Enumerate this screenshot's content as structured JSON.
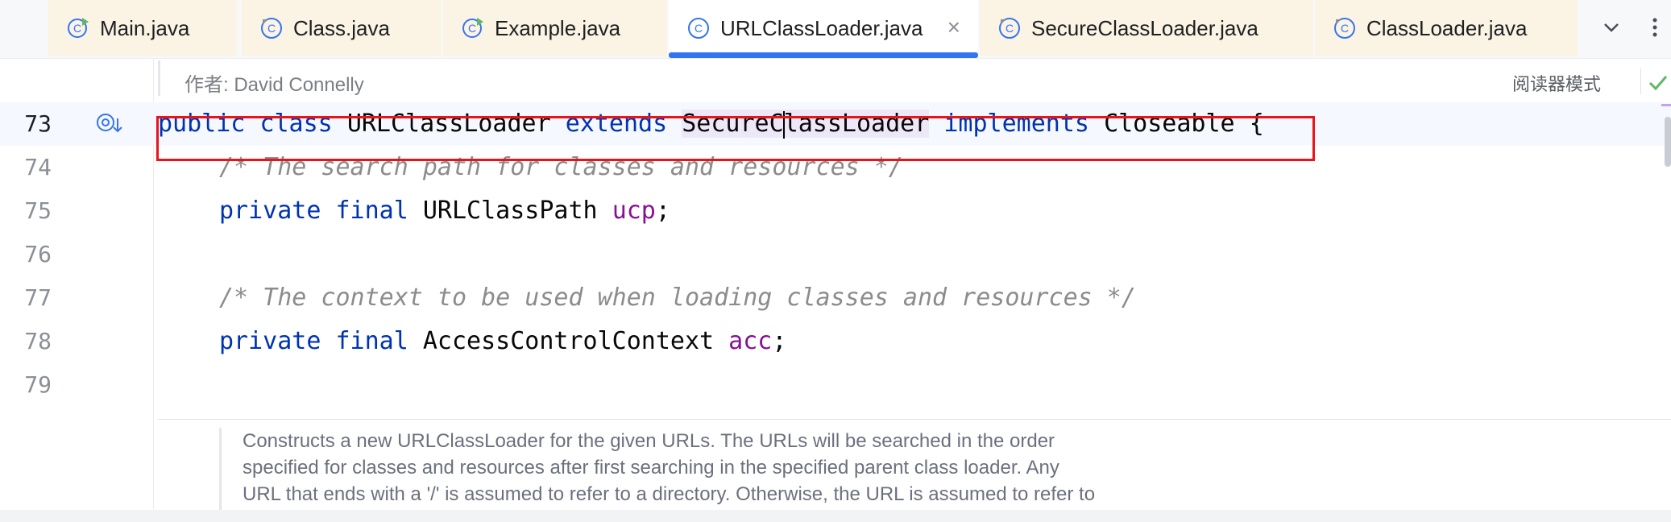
{
  "tabs": [
    {
      "label": "Main.java",
      "icon": "class-runnable-icon"
    },
    {
      "label": "Class.java",
      "icon": "class-icon"
    },
    {
      "label": "Example.java",
      "icon": "class-runnable-icon"
    },
    {
      "label": "URLClassLoader.java",
      "icon": "class-icon",
      "close": "×"
    },
    {
      "label": "SecureClassLoader.java",
      "icon": "class-icon"
    },
    {
      "label": "ClassLoader.java",
      "icon": "class-icon"
    }
  ],
  "author": "作者: David Connelly",
  "reader_mode": "阅读器模式",
  "lines": [
    {
      "num": "73",
      "t": [
        "public",
        "class",
        "URLClassLoader",
        "extends",
        "SecureC",
        "lassLoader",
        "implements",
        "Closeable",
        "{"
      ]
    },
    {
      "num": "74",
      "t": [
        "/* The search path for classes and resources */"
      ]
    },
    {
      "num": "75",
      "t": [
        "private",
        "final",
        "URLClassPath",
        "ucp",
        ";"
      ]
    },
    {
      "num": "76",
      "t": []
    },
    {
      "num": "77",
      "t": [
        "/* The context to be used when loading classes and resources */"
      ]
    },
    {
      "num": "78",
      "t": [
        "private",
        "final",
        "AccessControlContext",
        "acc",
        ";"
      ]
    },
    {
      "num": "79",
      "t": []
    }
  ],
  "doc_lines": [
    "Constructs a new URLClassLoader for the given URLs. The URLs will be searched in the order",
    "specified for classes and resources after first searching in the specified parent class loader. Any",
    "URL that ends with a '/' is assumed to refer to a directory. Otherwise, the URL is assumed to refer to"
  ],
  "colors": {
    "accent": "#3574f0",
    "keyword": "#0033b3",
    "field": "#871094",
    "comment": "#8c8c8c",
    "highlight_box": "#e8141c"
  }
}
